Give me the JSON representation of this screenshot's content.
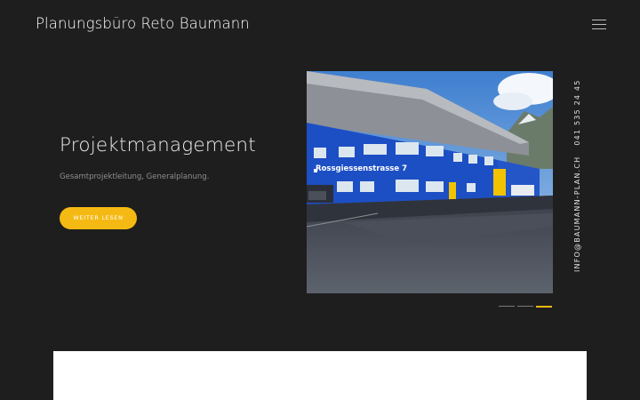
{
  "header": {
    "brand": "Planungsbüro Reto Baumann",
    "menu_icon": "hamburger-icon"
  },
  "hero": {
    "title": "Projektmanagement",
    "subtitle": "Gesamtprojektleitung, Generalplanung.",
    "cta_label": "WEITER LESEN",
    "accent_color": "#f5b913"
  },
  "slide": {
    "building_sign": "Rossgiessenstrasse 7"
  },
  "contact": {
    "email": "INFO@BAUMANN-PLAN.CH",
    "phone": "041 535 24 45"
  },
  "slider": {
    "count": 3,
    "active_index": 2
  }
}
